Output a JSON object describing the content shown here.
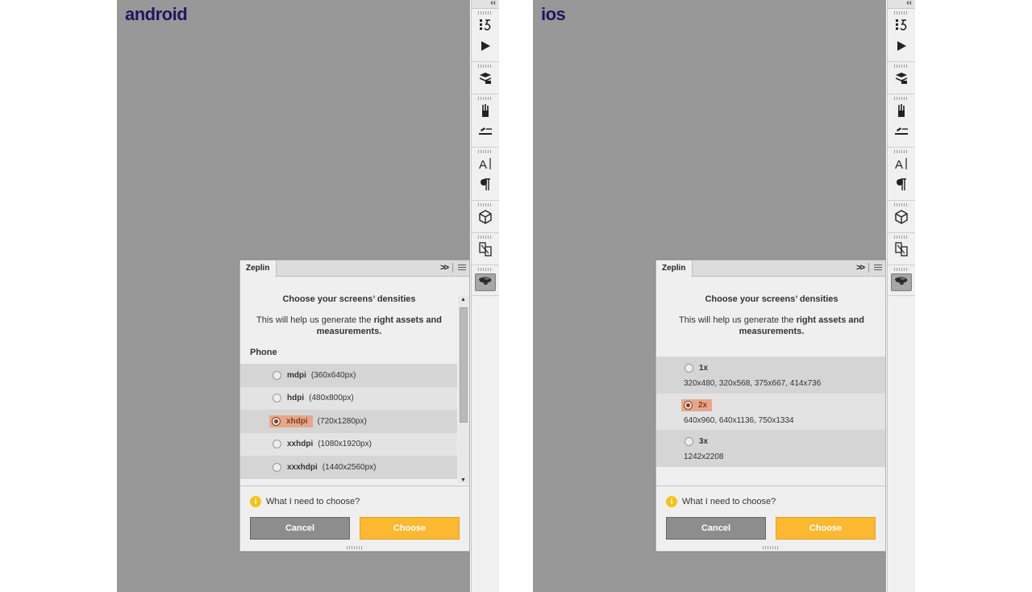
{
  "colors": {
    "canvas": "#989898",
    "platform_label": "#1d1860",
    "choose_button": "#fbb932",
    "cancel_button": "#8d8d8d",
    "selected_highlight": "#e5a88a",
    "info_icon": "#f5c41b"
  },
  "toolbar": {
    "collapse_icon": "‹‹",
    "groups": [
      [
        "history-icon",
        "play-icon"
      ],
      [
        "layer-comps-icon"
      ],
      [
        "brushes-icon",
        "brush-settings-icon"
      ],
      [
        "character-icon",
        "paragraph-icon"
      ],
      [
        "3d-cube-icon"
      ],
      [
        "device-preview-icon"
      ],
      [
        "zeplin-icon"
      ]
    ]
  },
  "android": {
    "platform_label": "android",
    "panel": {
      "tab": "Zeplin",
      "title": "Choose your screens’ densities",
      "desc_plain": "This will help us generate the ",
      "desc_bold": "right assets and measurements.",
      "section_label": "Phone",
      "densities": [
        {
          "name": "mdpi",
          "size": "(360x640px)",
          "selected": false
        },
        {
          "name": "hdpi",
          "size": "(480x800px)",
          "selected": false
        },
        {
          "name": "xhdpi",
          "size": "(720x1280px)",
          "selected": true
        },
        {
          "name": "xxhdpi",
          "size": "(1080x1920px)",
          "selected": false
        },
        {
          "name": "xxxhdpi",
          "size": "(1440x2560px)",
          "selected": false
        }
      ],
      "help_text": "What I need to choose?",
      "cancel_label": "Cancel",
      "choose_label": "Choose"
    }
  },
  "ios": {
    "platform_label": "ios",
    "panel": {
      "tab": "Zeplin",
      "title": "Choose your screens’ densities",
      "desc_plain": "This will help us generate the ",
      "desc_bold": "right assets and measurements.",
      "densities": [
        {
          "name": "1x",
          "sizes": "320x480, 320x568, 375x667, 414x736",
          "selected": false
        },
        {
          "name": "2x",
          "sizes": "640x960, 640x1136, 750x1334",
          "selected": true
        },
        {
          "name": "3x",
          "sizes": "1242x2208",
          "selected": false
        }
      ],
      "help_text": "What I need to choose?",
      "cancel_label": "Cancel",
      "choose_label": "Choose"
    }
  }
}
